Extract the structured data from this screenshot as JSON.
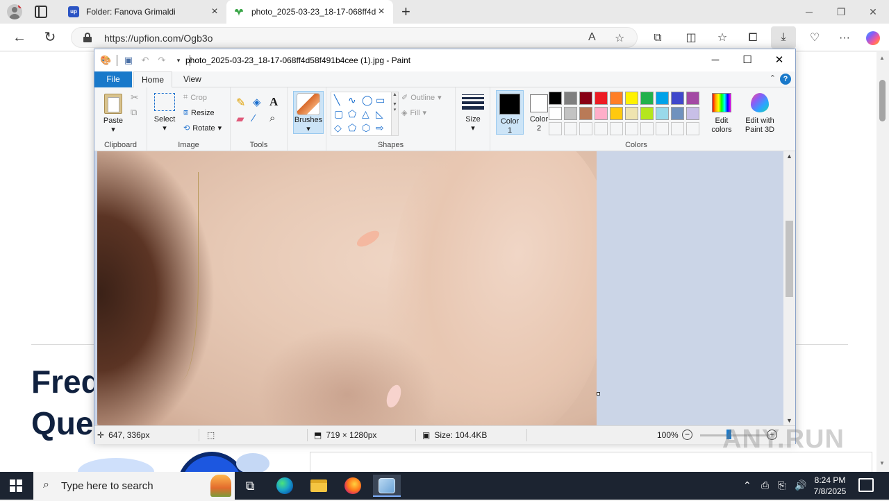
{
  "browser": {
    "tabs": [
      {
        "title": "Folder: Fanova Grimaldi",
        "favicon": "up"
      },
      {
        "title": "photo_2025-03-23_18-17-068ff4d",
        "favicon": "leaf"
      }
    ],
    "url": "https://upfion.com/Ogb3o"
  },
  "webpage": {
    "headline_line1": "Freq",
    "headline_line2": "Que"
  },
  "paint": {
    "title": "photo_2025-03-23_18-17-068ff4d58f491b4cee (1).jpg - Paint",
    "tabs": {
      "file": "File",
      "home": "Home",
      "view": "View"
    },
    "clipboard": {
      "paste": "Paste",
      "label": "Clipboard"
    },
    "image": {
      "select": "Select",
      "crop": "Crop",
      "resize": "Resize",
      "rotate": "Rotate",
      "label": "Image"
    },
    "tools": {
      "label": "Tools"
    },
    "brushes": {
      "label": "Brushes"
    },
    "shapes": {
      "outline": "Outline",
      "fill": "Fill",
      "label": "Shapes"
    },
    "size": {
      "label": "Size"
    },
    "colors": {
      "color1": "Color",
      "color1_num": "1",
      "color2": "Color",
      "color2_num": "2",
      "edit_colors": "Edit colors",
      "edit_paint3d": "Edit with Paint 3D",
      "label": "Colors",
      "palette_row1": [
        "#000000",
        "#7f7f7f",
        "#880015",
        "#ed1c24",
        "#ff7f27",
        "#fff200",
        "#22b14c",
        "#00a2e8",
        "#3f48cc",
        "#a349a4"
      ],
      "palette_row2": [
        "#ffffff",
        "#c3c3c3",
        "#b97a57",
        "#ffaec9",
        "#ffc90e",
        "#efe4b0",
        "#b5e61d",
        "#99d9ea",
        "#7092be",
        "#c8bfe7"
      ]
    },
    "status": {
      "cursor": "647, 336px",
      "dimensions": "719 × 1280px",
      "size": "Size: 104.4KB",
      "zoom": "100%"
    }
  },
  "watermark": "ANY.RUN",
  "taskbar": {
    "search_placeholder": "Type here to search",
    "time": "8:24 PM",
    "date": "7/8/2025"
  }
}
